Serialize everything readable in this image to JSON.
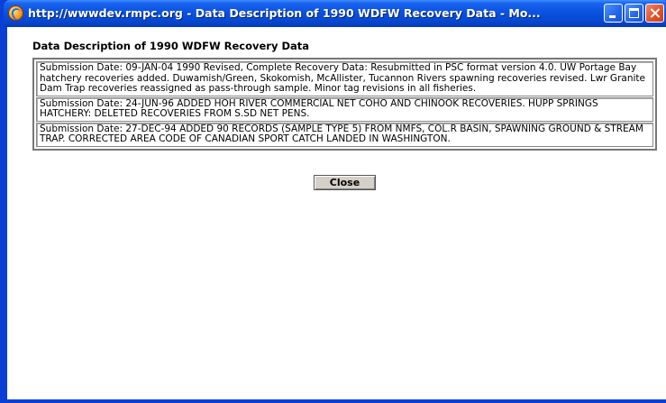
{
  "window": {
    "title": "http://wwwdev.rmpc.org - Data Description of 1990 WDFW Recovery Data - Mo...",
    "icon": "browser-app-icon",
    "controls": {
      "minimize_icon": "minimize-icon",
      "maximize_icon": "maximize-icon",
      "close_icon": "close-icon"
    }
  },
  "page": {
    "heading": "Data Description of 1990 WDFW Recovery Data",
    "entries": [
      {
        "text": "Submission Date: 09-JAN-04 1990 Revised, Complete Recovery Data: Resubmitted in PSC format version 4.0. UW Portage Bay hatchery recoveries added. Duwamish/Green, Skokomish, McAllister, Tucannon Rivers spawning recoveries revised. Lwr Granite Dam Trap recoveries reassigned as pass-through sample. Minor tag revisions in all fisheries."
      },
      {
        "text": "Submission Date: 24-JUN-96 ADDED HOH RIVER COMMERCIAL NET COHO AND CHINOOK RECOVERIES. HUPP SPRINGS HATCHERY: DELETED RECOVERIES FROM S.SD NET PENS."
      },
      {
        "text": "Submission Date: 27-DEC-94 ADDED 90 RECORDS (SAMPLE TYPE 5) FROM NMFS, COL.R BASIN, SPAWNING GROUND & STREAM TRAP. CORRECTED AREA CODE OF CANADIAN SPORT CATCH LANDED IN WASHINGTON."
      }
    ],
    "close_label": "Close"
  },
  "colors": {
    "titlebar": "#0a52e0",
    "frame": "#0a3fd6",
    "button_face": "#d4d0c8"
  }
}
